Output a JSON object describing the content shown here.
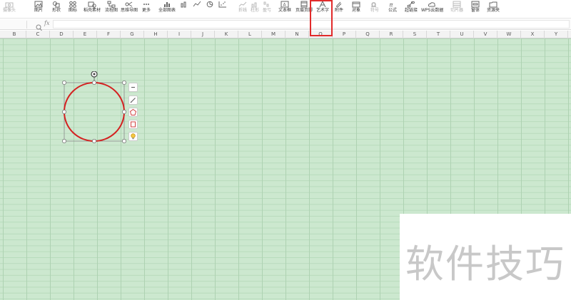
{
  "ribbon": {
    "items": [
      {
        "label": "摄像头",
        "icon": "camera-icon",
        "disabled": true
      },
      {
        "label": "图片",
        "icon": "image-icon",
        "disabled": false
      },
      {
        "label": "形状",
        "icon": "shapes-icon",
        "disabled": false
      },
      {
        "label": "图标",
        "icon": "icons-icon",
        "disabled": false
      },
      {
        "label": "稻壳素材",
        "icon": "material-icon",
        "disabled": false
      },
      {
        "label": "流程图",
        "icon": "flowchart-icon",
        "disabled": false
      },
      {
        "label": "思维导图",
        "icon": "mindmap-icon",
        "disabled": false
      },
      {
        "label": "更多",
        "icon": "more-icon",
        "disabled": false
      },
      {
        "label": "全部图表",
        "icon": "all-charts-icon",
        "disabled": false
      },
      {
        "label": "",
        "icon": "column-chart-icon",
        "disabled": false
      },
      {
        "label": "",
        "icon": "line-chart-icon",
        "disabled": false
      },
      {
        "label": "",
        "icon": "pie-chart-icon",
        "disabled": false
      },
      {
        "label": "",
        "icon": "scatter-chart-icon",
        "disabled": false
      },
      {
        "label": "折线",
        "icon": "sparkline-line-icon",
        "disabled": true
      },
      {
        "label": "柱形",
        "icon": "sparkline-column-icon",
        "disabled": true
      },
      {
        "label": "盈亏",
        "icon": "sparkline-winloss-icon",
        "disabled": true
      },
      {
        "label": "文本框",
        "icon": "textbox-icon",
        "disabled": false
      },
      {
        "label": "页眉页脚",
        "icon": "header-footer-icon",
        "disabled": false
      },
      {
        "label": "艺术字",
        "icon": "wordart-icon",
        "disabled": false
      },
      {
        "label": "附件",
        "icon": "attachment-icon",
        "disabled": false
      },
      {
        "label": "对象",
        "icon": "object-icon",
        "disabled": false
      },
      {
        "label": "符号",
        "icon": "symbol-icon",
        "disabled": true
      },
      {
        "label": "公式",
        "icon": "formula-icon",
        "disabled": false
      },
      {
        "label": "超链接",
        "icon": "hyperlink-icon",
        "disabled": false
      },
      {
        "label": "WPS云数据",
        "icon": "cloud-data-icon",
        "disabled": false
      },
      {
        "label": "切片器",
        "icon": "slicer-icon",
        "disabled": true
      },
      {
        "label": "窗体",
        "icon": "form-icon",
        "disabled": false
      },
      {
        "label": "资源夹",
        "icon": "resource-icon",
        "disabled": false
      }
    ]
  },
  "formula_bar": {
    "cell_ref": "",
    "fx_label": "fx",
    "value": ""
  },
  "columns": [
    "B",
    "C",
    "D",
    "E",
    "F",
    "G",
    "H",
    "I",
    "J",
    "K",
    "L",
    "M",
    "N",
    "O",
    "P",
    "Q",
    "R",
    "S",
    "T",
    "U",
    "V",
    "W",
    "X",
    "Y"
  ],
  "shape": {
    "type": "ellipse",
    "stroke_color": "#d42020",
    "handle_color": "#ffffff"
  },
  "side_tools": [
    {
      "icon": "collapse-icon"
    },
    {
      "icon": "pen-icon"
    },
    {
      "icon": "shape-style-icon"
    },
    {
      "icon": "outline-icon"
    },
    {
      "icon": "lightbulb-icon"
    }
  ],
  "highlight": {
    "target": "wordart-button",
    "color": "#e12b2b"
  },
  "watermark": {
    "text": "软件技巧"
  }
}
